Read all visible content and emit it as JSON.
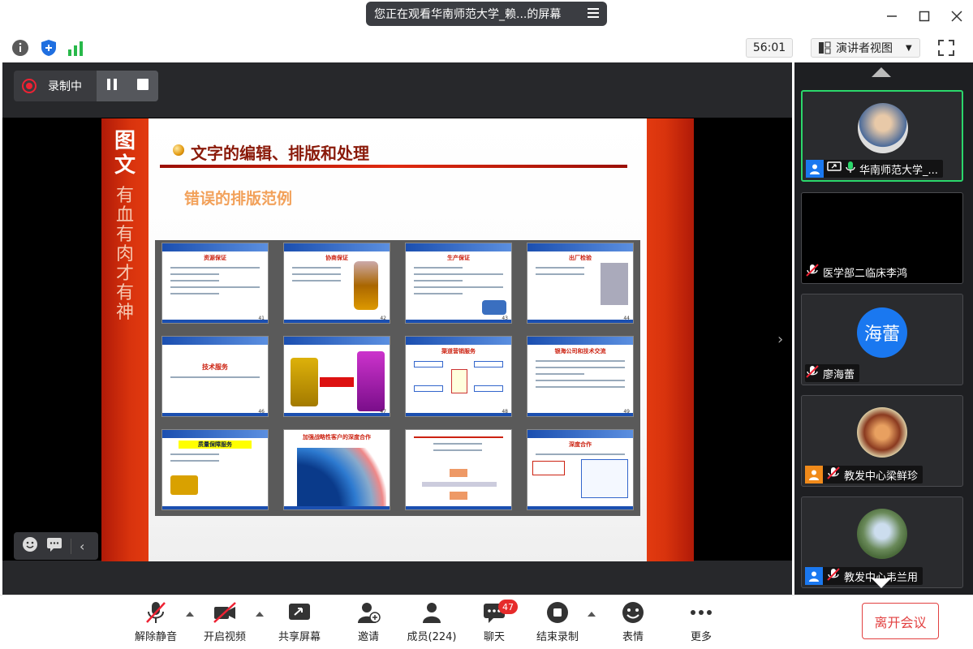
{
  "title_bar": {
    "title": "您正在观看华南师范大学_赖...的屏幕"
  },
  "toolbar": {
    "timer": "56:01",
    "view_label": "演讲者视图"
  },
  "recording": {
    "label": "录制中"
  },
  "slide": {
    "side_big": [
      "图",
      "文"
    ],
    "side_small": [
      "有",
      "血",
      "有",
      "肉",
      "才",
      "有",
      "神"
    ],
    "title": "文字的编辑、排版和处理",
    "subtitle": "错误的排版范例",
    "thumbnails": [
      {
        "title": "资源保证",
        "num": "41"
      },
      {
        "title": "协商保证",
        "num": "42"
      },
      {
        "title": "生产保证",
        "num": "43"
      },
      {
        "title": "出厂检验",
        "num": "44"
      },
      {
        "title": "技术服务",
        "num": "46"
      },
      {
        "title": "",
        "num": "47"
      },
      {
        "title": "渠道营销服务",
        "num": "48"
      },
      {
        "title": "银海公司和技术交流",
        "num": "49"
      },
      {
        "title": "质量保障服务",
        "num": ""
      },
      {
        "title": "加强战略性客户的深度合作",
        "num": ""
      },
      {
        "title": "",
        "num": ""
      },
      {
        "title": "深度合作",
        "num": ""
      }
    ]
  },
  "participants": [
    {
      "name": "华南师范大学_...",
      "type": "photo",
      "active": true
    },
    {
      "name": "医学部二临床李鸿",
      "type": "blank",
      "active": false
    },
    {
      "name": "廖海蕾",
      "type": "text",
      "avatar_text": "海蕾",
      "active": false
    },
    {
      "name": "教发中心梁鲜珍",
      "type": "photo",
      "active": false
    },
    {
      "name": "教发中心韦兰用",
      "type": "photo",
      "active": false
    }
  ],
  "bottom_bar": {
    "mute_label": "解除静音",
    "video_label": "开启视频",
    "share_label": "共享屏幕",
    "invite_label": "邀请",
    "members_label": "成员(224)",
    "chat_label": "聊天",
    "chat_badge": "47",
    "end_record_label": "结束录制",
    "emoji_label": "表情",
    "more_label": "更多",
    "leave_label": "离开会议"
  },
  "colors": {
    "accent_green": "#2bd76b",
    "leave_red": "#e24040",
    "badge_red": "#e62b2b",
    "avatar_blue": "#1a78f0"
  }
}
